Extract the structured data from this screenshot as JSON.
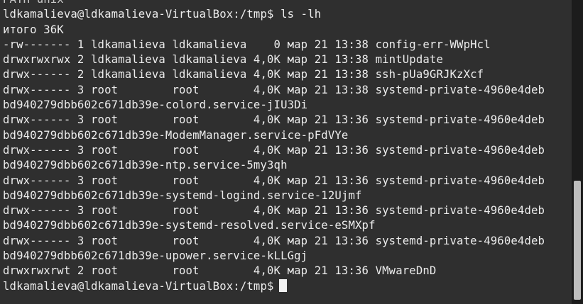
{
  "terminal": {
    "lines": [
      "PATH unix",
      "ldkamalieva@ldkamalieva-VirtualBox:/tmp$ ls -lh",
      "итого 36K",
      "-rw------- 1 ldkamalieva ldkamalieva    0 мар 21 13:38 config-err-WWpHcl",
      "drwxrwxrwx 2 ldkamalieva ldkamalieva 4,0K мар 21 13:38 mintUpdate",
      "drwx------ 2 ldkamalieva ldkamalieva 4,0K мар 21 13:38 ssh-pUa9GRJKzXcf",
      "drwx------ 3 root        root        4,0K мар 21 13:38 systemd-private-4960e4deb",
      "bd940279dbb602c671db39e-colord.service-jIU3Di",
      "drwx------ 3 root        root        4,0K мар 21 13:36 systemd-private-4960e4deb",
      "bd940279dbb602c671db39e-ModemManager.service-pFdVYe",
      "drwx------ 3 root        root        4,0K мар 21 13:36 systemd-private-4960e4deb",
      "bd940279dbb602c671db39e-ntp.service-5my3qh",
      "drwx------ 3 root        root        4,0K мар 21 13:36 systemd-private-4960e4deb",
      "bd940279dbb602c671db39e-systemd-logind.service-12Ujmf",
      "drwx------ 3 root        root        4,0K мар 21 13:36 systemd-private-4960e4deb",
      "bd940279dbb602c671db39e-systemd-resolved.service-eSMXpf",
      "drwx------ 3 root        root        4,0K мар 21 13:36 systemd-private-4960e4deb",
      "bd940279dbb602c671db39e-upower.service-kLLGgj",
      "drwxrwxrwt 2 root        root        4,0K мар 21 13:36 VMwareDnD"
    ],
    "prompt": "ldkamalieva@ldkamalieva-VirtualBox:/tmp$"
  }
}
